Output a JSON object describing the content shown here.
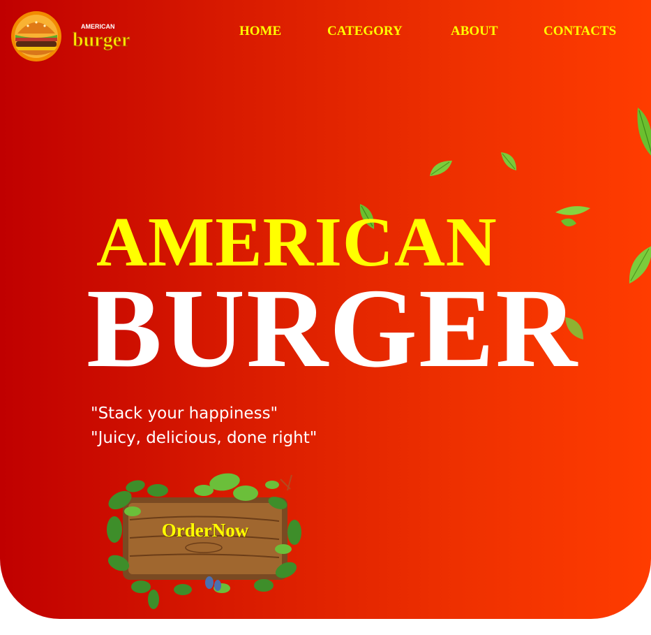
{
  "logo": {
    "top_text": "AMERICAN",
    "brand": "burger"
  },
  "nav": {
    "items": [
      "HOME",
      "CATEGORY",
      "ABOUT",
      "CONTACTS"
    ]
  },
  "hero": {
    "title_line1": "AMERICAN",
    "title_line2": "BURGER",
    "taglines": [
      "\"Stack your happiness\"",
      "\"Juicy, delicious, done right\""
    ],
    "cta_label": "OrderNow"
  },
  "colors": {
    "gradient_start": "#c00000",
    "gradient_end": "#ff3c00",
    "accent_yellow": "#ffff00",
    "title_white": "#ffffff"
  }
}
